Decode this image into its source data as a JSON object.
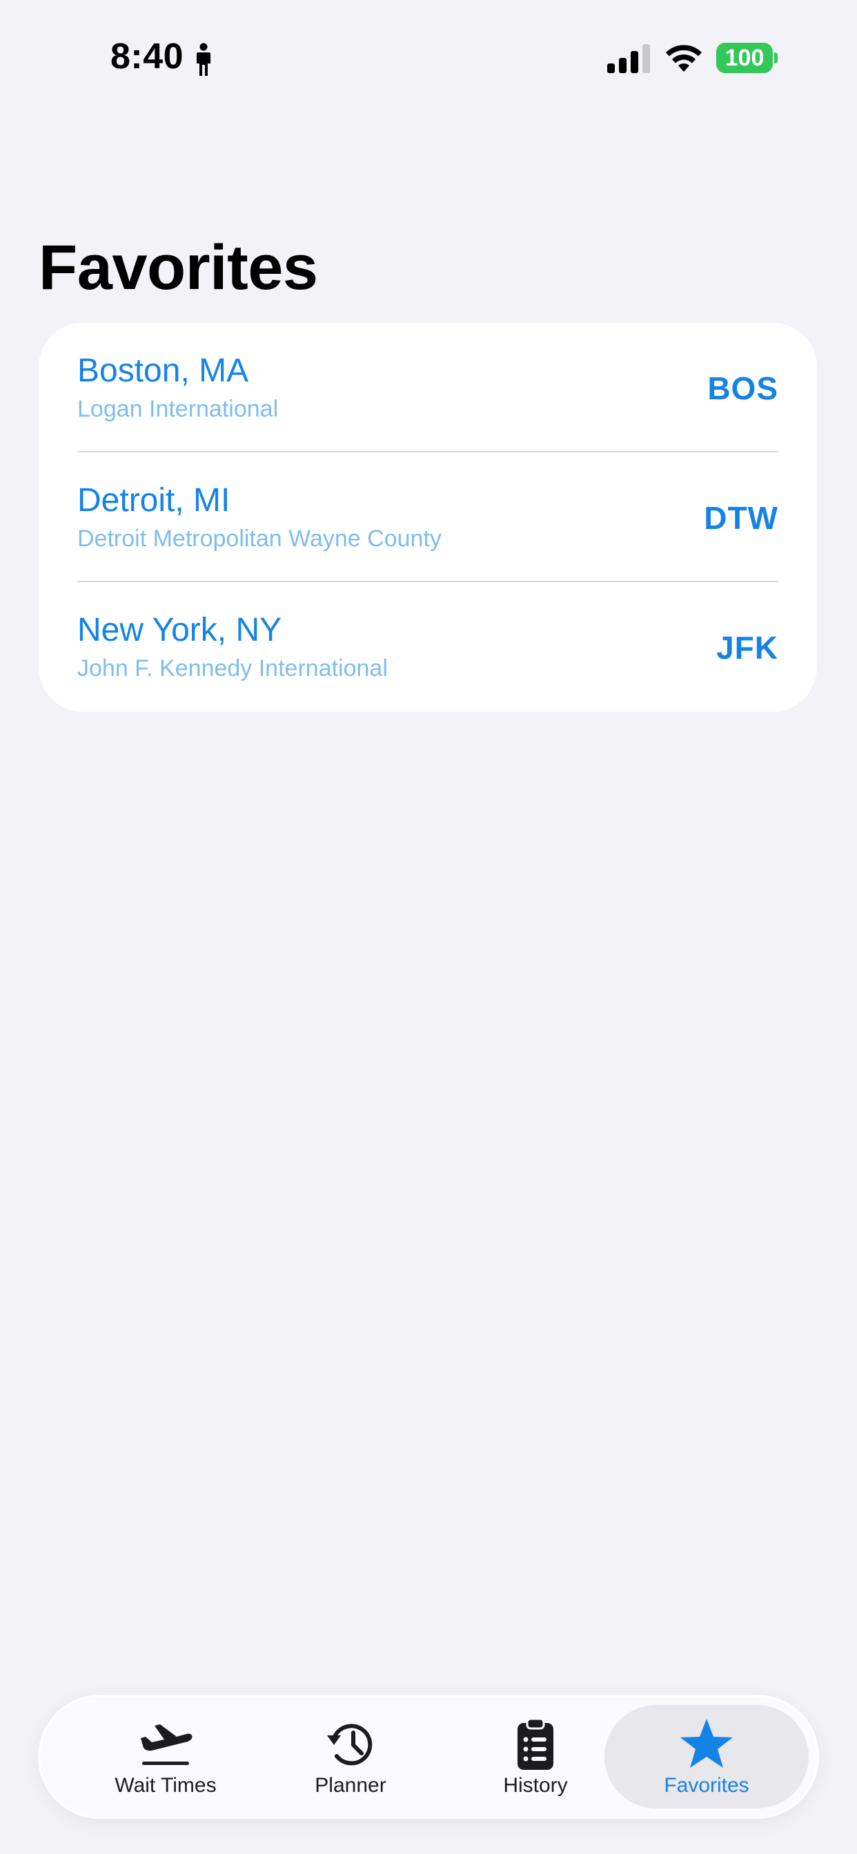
{
  "status_bar": {
    "time": "8:40",
    "battery": "100",
    "battery_color": "#34c759"
  },
  "page": {
    "title": "Favorites"
  },
  "favorites": [
    {
      "city": "Boston, MA",
      "airport": "Logan International",
      "code": "BOS"
    },
    {
      "city": "Detroit, MI",
      "airport": "Detroit Metropolitan Wayne County",
      "code": "DTW"
    },
    {
      "city": "New York, NY",
      "airport": "John F. Kennedy International",
      "code": "JFK"
    }
  ],
  "tab_bar": {
    "active": "favorites",
    "tabs": [
      {
        "id": "wait-times",
        "label": "Wait Times",
        "icon": "airplane-departure-icon"
      },
      {
        "id": "planner",
        "label": "Planner",
        "icon": "clock-history-icon"
      },
      {
        "id": "history",
        "label": "History",
        "icon": "clipboard-list-icon"
      },
      {
        "id": "favorites",
        "label": "Favorites",
        "icon": "star-icon"
      }
    ]
  },
  "colors": {
    "accent": "#1583e6",
    "secondary_text": "#7fbdee",
    "background": "#f2f2f7"
  }
}
